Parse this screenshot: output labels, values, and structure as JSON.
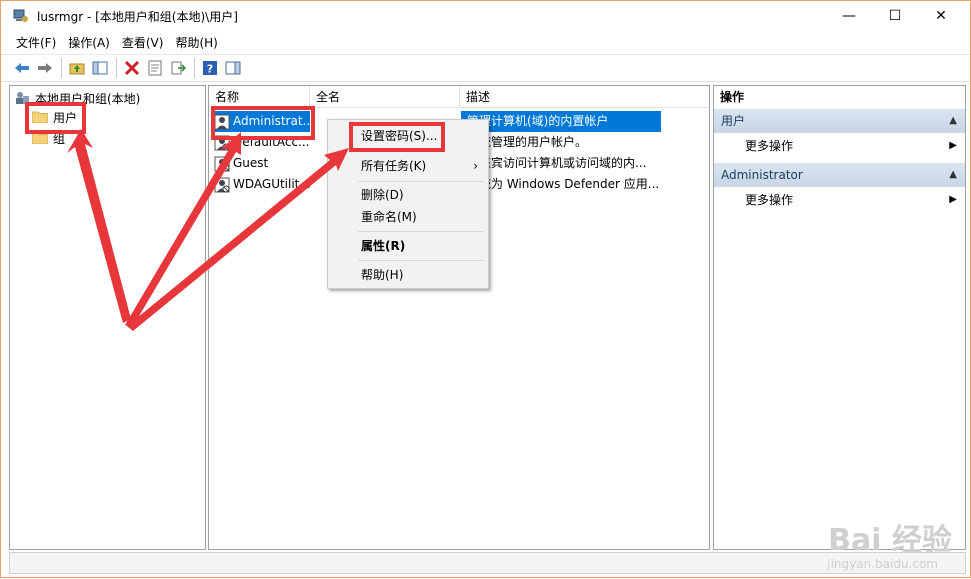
{
  "window": {
    "title": "lusrmgr - [本地用户和组(本地)\\用户]"
  },
  "window_controls": {
    "minimize": "—",
    "maximize": "☐",
    "close": "✕"
  },
  "menu": [
    "文件(F)",
    "操作(A)",
    "查看(V)",
    "帮助(H)"
  ],
  "tree": {
    "root": "本地用户和组(本地)",
    "children": [
      "用户",
      "组"
    ]
  },
  "list": {
    "columns": [
      "名称",
      "全名",
      "描述"
    ],
    "rows": [
      {
        "name": "Administrat...",
        "fullname": "",
        "description": "管理计算机(域)的内置帐户",
        "selected": true
      },
      {
        "name": "DefaultAcc...",
        "fullname": "",
        "description": "系统管理的用户帐户。"
      },
      {
        "name": "Guest",
        "fullname": "",
        "description": "供来宾访问计算机或访问域的内..."
      },
      {
        "name": "WDAGUtilit...",
        "fullname": "",
        "description": "系统为 Windows Defender 应用..."
      }
    ]
  },
  "context_menu": {
    "items": [
      {
        "label": "设置密码(S)..."
      },
      {
        "label": "所有任务(K)",
        "submenu": "›"
      },
      {
        "label": "删除(D)"
      },
      {
        "label": "重命名(M)"
      },
      {
        "label": "属性(R)",
        "bold": true
      },
      {
        "label": "帮助(H)"
      }
    ]
  },
  "actions": {
    "header": "操作",
    "sections": [
      {
        "title": "用户",
        "item": "更多操作"
      },
      {
        "title": "Administrator",
        "item": "更多操作"
      }
    ]
  },
  "watermark": {
    "brand": "Bai 经验",
    "url": "jingyan.baidu.com"
  },
  "colors": {
    "selection": "#0078d7",
    "annotation": "#e8373a",
    "section_bg": "#ccd9e8"
  }
}
